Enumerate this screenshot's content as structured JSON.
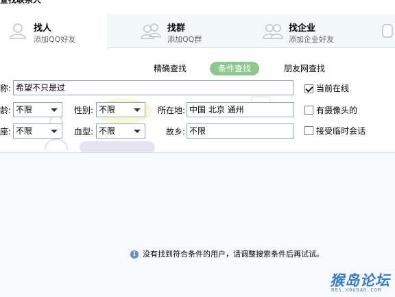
{
  "window": {
    "title": "查找联系人"
  },
  "category_tabs": [
    {
      "title": "找人",
      "subtitle": "添加QQ好友",
      "icon": "person-icon"
    },
    {
      "title": "找群",
      "subtitle": "添加QQ群",
      "icon": "group-icon"
    },
    {
      "title": "找企业",
      "subtitle": "添加企业好友",
      "icon": "enterprise-icon"
    }
  ],
  "mode_tabs": [
    {
      "label": "精确查找",
      "active": false
    },
    {
      "label": "条件查找",
      "active": true
    },
    {
      "label": "朋友网查找",
      "active": false
    }
  ],
  "form": {
    "nickname": {
      "label": "称:",
      "value": "希望不只是过"
    },
    "age": {
      "label": "龄:",
      "value": "不限"
    },
    "gender": {
      "label": "性别:",
      "value": "不限"
    },
    "location": {
      "label": "所在地:",
      "value": "中国  北京  通州"
    },
    "zodiac": {
      "label": "座:",
      "value": "不限"
    },
    "blood_type": {
      "label": "血型:",
      "value": "不限"
    },
    "hometown": {
      "label": "故乡:",
      "value": "不限"
    }
  },
  "options": [
    {
      "label": "当前在线",
      "checked": true
    },
    {
      "label": "有摄像头的",
      "checked": false
    },
    {
      "label": "接受临时会话",
      "checked": false
    }
  ],
  "results": {
    "empty_message": "没有找到符合条件的用户，请调整搜索条件后再试试。",
    "info_icon": "info-icon"
  },
  "watermark": {
    "text": "猴岛论坛",
    "url": "BBS.HOUDAO.COM"
  },
  "colors": {
    "accent_green": "#8ec88e",
    "panel_bg": "#f3f8fb",
    "results_bg": "#f7fafc",
    "border": "#8fa4b5"
  }
}
